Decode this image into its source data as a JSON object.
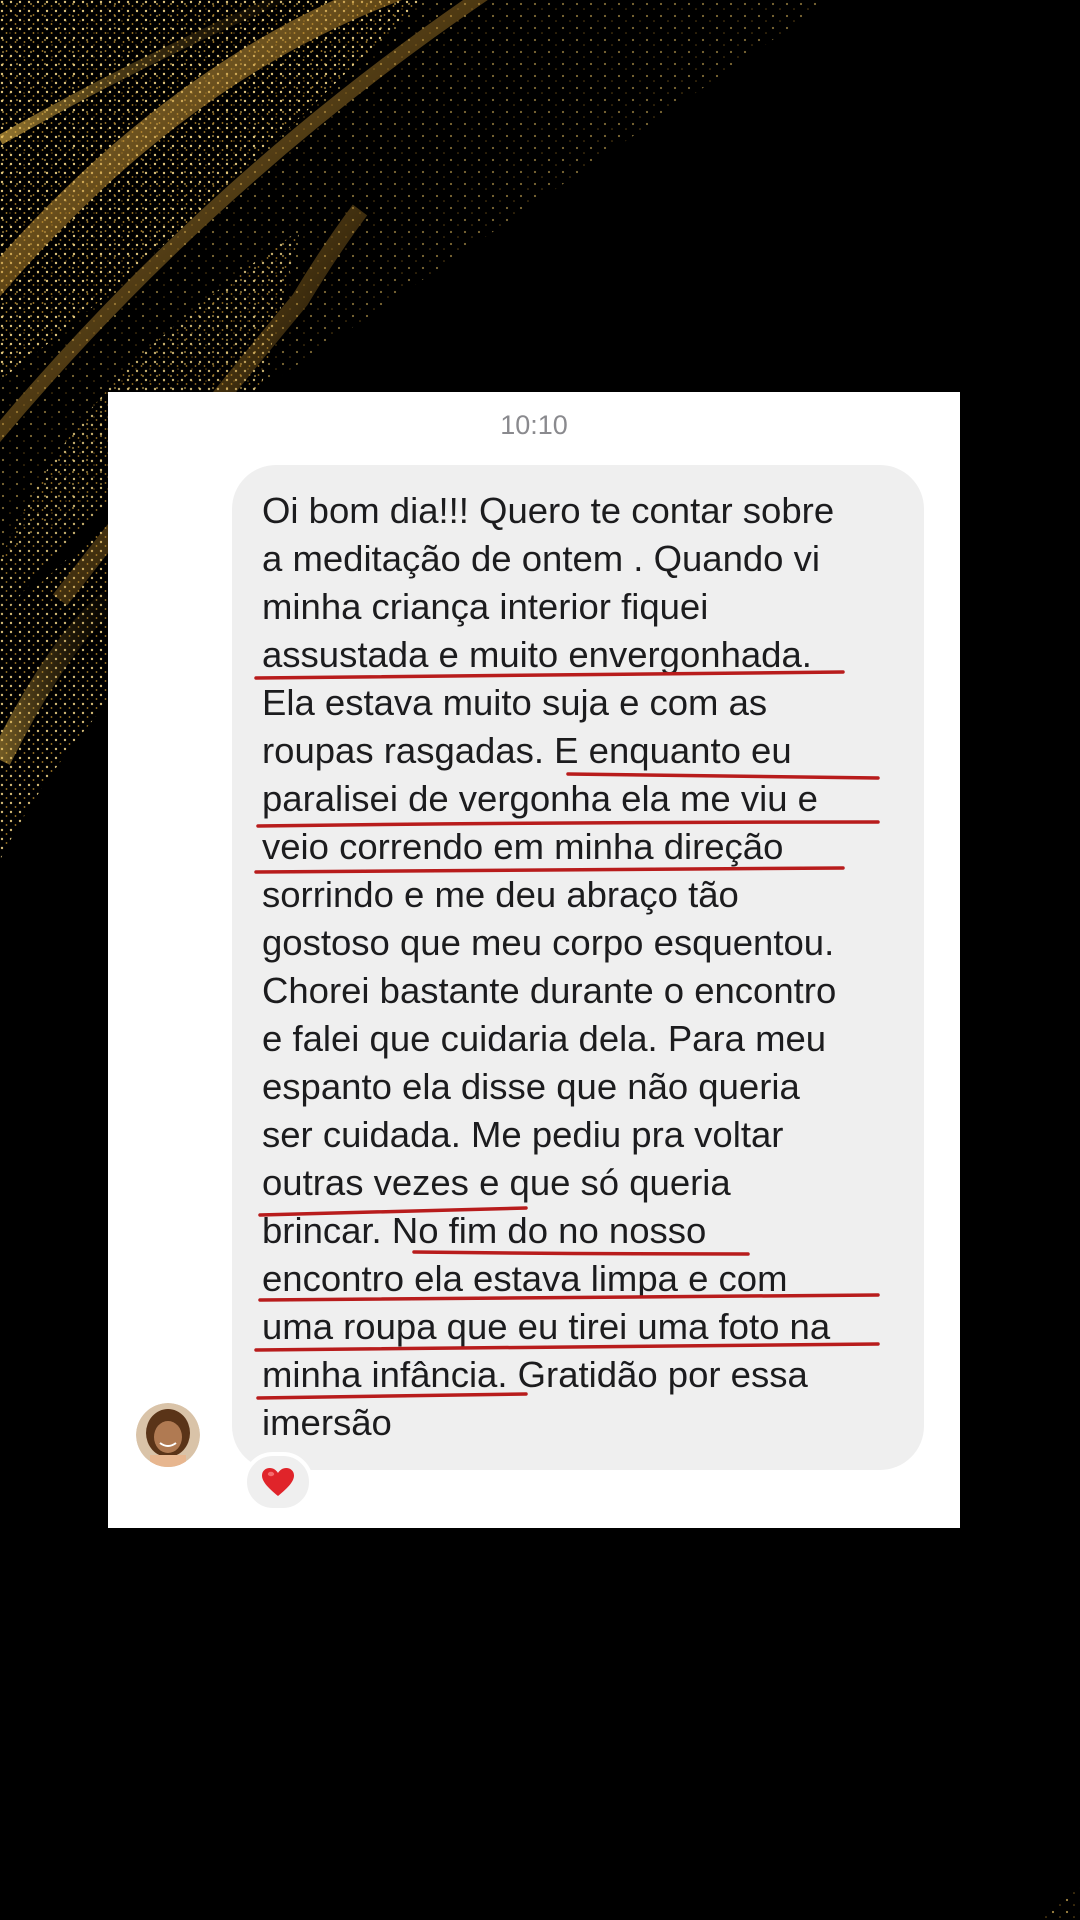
{
  "chat": {
    "timestamp": "10:10",
    "message_lines": [
      "Oi bom dia!!! Quero te contar sobre",
      "a meditação de ontem . Quando vi",
      "minha criança interior  fiquei",
      "assustada e muito envergonhada.",
      "Ela estava muito suja e com as",
      "roupas rasgadas.  E enquanto eu",
      "paralisei de vergonha ela me viu  e",
      "veio correndo em minha direção",
      "sorrindo e me deu abraço tão",
      "gostoso que meu corpo esquentou.",
      "Chorei bastante durante o encontro",
      "e falei que cuidaria dela. Para meu",
      "espanto ela disse que não queria",
      "ser cuidada. Me pediu pra voltar",
      "outras vezes e que só queria",
      "brincar. No fim do no nosso",
      "encontro ela estava limpa e com",
      "uma roupa que eu tirei uma foto na",
      "minha infância.  Gratidão por essa",
      "imersão"
    ],
    "reaction": {
      "icon": "red-heart-icon",
      "color": "#e0242a"
    },
    "sender_avatar": "avatar"
  },
  "colors": {
    "background": "#000000",
    "bubble": "#efefef",
    "underline": "#b81c1c",
    "gold": "#d9a83a"
  }
}
